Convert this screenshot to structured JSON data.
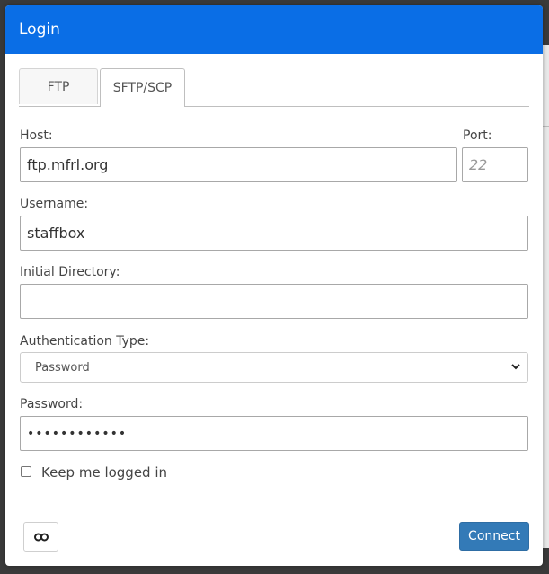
{
  "dialog": {
    "title": "Login"
  },
  "tabs": [
    {
      "label": "FTP",
      "active": false
    },
    {
      "label": "SFTP/SCP",
      "active": true
    }
  ],
  "form": {
    "host": {
      "label": "Host:",
      "value": "ftp.mfrl.org"
    },
    "port": {
      "label": "Port:",
      "value": "",
      "placeholder": "22"
    },
    "username": {
      "label": "Username:",
      "value": "staffbox"
    },
    "initial_directory": {
      "label": "Initial Directory:",
      "value": ""
    },
    "auth_type": {
      "label": "Authentication Type:",
      "selected": "Password"
    },
    "password": {
      "label": "Password:",
      "masked_value": "••••••••••••"
    },
    "keep_logged_in": {
      "label": "Keep me logged in",
      "checked": false
    }
  },
  "footer": {
    "link_icon": "link-icon",
    "connect_label": "Connect"
  },
  "colors": {
    "header_bg": "#0a6ee6",
    "connect_bg": "#337ab7"
  }
}
